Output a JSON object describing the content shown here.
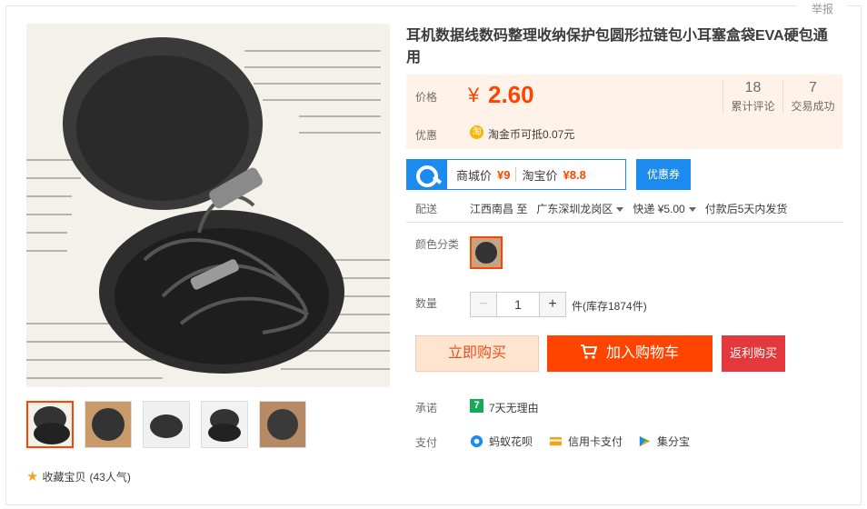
{
  "report_label": "举报",
  "product": {
    "title": "耳机数据线数码整理收纳保护包圆形拉链包小耳塞盒袋EVA硬包通用",
    "favorite_label": "收藏宝贝",
    "favorite_count": "(43人气)"
  },
  "price": {
    "label": "价格",
    "symbol": "¥",
    "value": "2.60",
    "stats": [
      {
        "num": "18",
        "label": "累计评论"
      },
      {
        "num": "7",
        "label": "交易成功"
      }
    ],
    "discount_label": "优惠",
    "coin_icon": "淘",
    "coin_text": "淘金币可抵0.07元"
  },
  "promo": {
    "mall_label": "商城价",
    "mall_price": "¥9",
    "taobao_label": "淘宝价",
    "taobao_price": "¥8.8",
    "coupon_button": "优惠券"
  },
  "shipping": {
    "label": "配送",
    "from": "江西南昌 至",
    "to": "广东深圳龙岗区",
    "method": "快递 ¥5.00",
    "time": "付款后5天内发货"
  },
  "color": {
    "label": "颜色分类"
  },
  "quantity": {
    "label": "数量",
    "minus": "−",
    "value": "1",
    "plus": "+",
    "stock": "件(库存1874件)"
  },
  "actions": {
    "buy_now": "立即购买",
    "add_cart": "加入购物车",
    "rebate": "返利购买"
  },
  "promise": {
    "label": "承诺",
    "icon": "7",
    "text": "7天无理由"
  },
  "payment": {
    "label": "支付",
    "methods": [
      "蚂蚁花呗",
      "信用卡支付",
      "集分宝"
    ]
  },
  "colors": {
    "accent": "#ff4400",
    "price_bg": "#fff2e8",
    "promo_blue": "#1b8bef"
  }
}
